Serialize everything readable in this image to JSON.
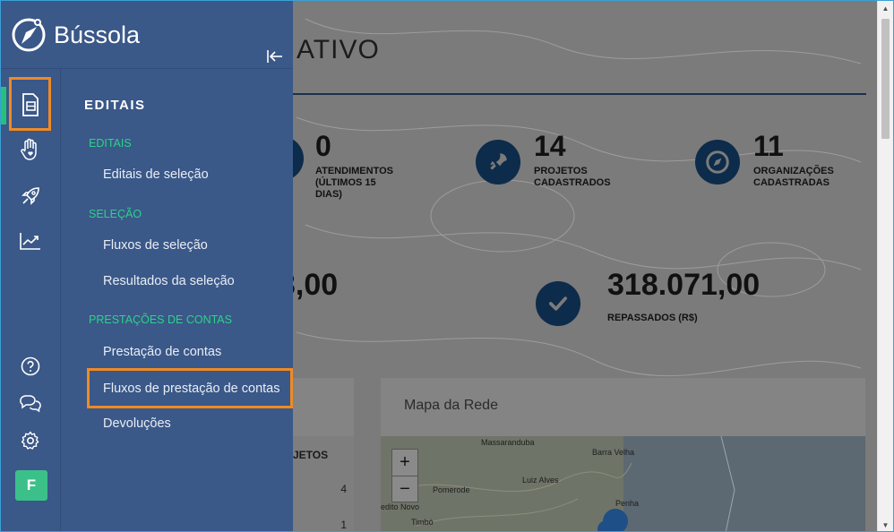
{
  "brand": {
    "name": "Bússola",
    "logo_icon": "compass-logo-icon"
  },
  "colors": {
    "sidebar": "#3a5888",
    "accent_green": "#27c07a",
    "section_green": "#2fd18a",
    "highlight": "#f08a24",
    "dark_navy": "#0d2b4a"
  },
  "rail": {
    "items": [
      {
        "name": "editais",
        "icon": "document-icon",
        "active": true
      },
      {
        "name": "atendimentos",
        "icon": "hand-heart-icon"
      },
      {
        "name": "projetos",
        "icon": "rocket-icon"
      },
      {
        "name": "relatorios",
        "icon": "chart-line-icon"
      }
    ],
    "bottom": [
      {
        "name": "help",
        "icon": "help-circle-icon"
      },
      {
        "name": "chat",
        "icon": "chat-icon"
      },
      {
        "name": "settings",
        "icon": "gear-icon"
      }
    ],
    "avatar_initial": "F"
  },
  "menu": {
    "title": "EDITAIS",
    "sections": [
      {
        "label": "EDITAIS",
        "links": [
          "Editais de seleção"
        ]
      },
      {
        "label": "SELEÇÃO",
        "links": [
          "Fluxos de seleção",
          "Resultados da seleção"
        ]
      },
      {
        "label": "PRESTAÇÕES DE CONTAS",
        "links": [
          "Prestação de contas",
          "Fluxos de prestação de contas",
          "Devoluções"
        ]
      }
    ]
  },
  "dashboard": {
    "title_fragment": "ATIVO",
    "stats": [
      {
        "value": "0",
        "label_lines": [
          "ATENDIMENTOS",
          "(ÚLTIMOS 15",
          "DIAS)"
        ]
      },
      {
        "value": "14",
        "label_lines": [
          "PROJETOS",
          "CADASTRADOS"
        ],
        "icon": "rocket-icon"
      },
      {
        "value": "11",
        "label_lines": [
          "ORGANIZAÇÕES",
          "CADASTRADAS"
        ],
        "icon": "compass-icon"
      }
    ],
    "money_left_fragment": "3,00",
    "money_right": {
      "value": "318.071,00",
      "label": "REPASSADOS (R$)",
      "icon": "check-icon"
    },
    "table_fragment": {
      "header": "JETOS",
      "rows": [
        "4",
        "1"
      ]
    },
    "map": {
      "title": "Mapa da Rede",
      "zoom_in": "+",
      "zoom_out": "−",
      "labels": [
        "Massaranduba",
        "Barra Velha",
        "Luiz Alves",
        "Pomerode",
        "Penha",
        "edito Novo",
        "Timbó"
      ]
    }
  }
}
